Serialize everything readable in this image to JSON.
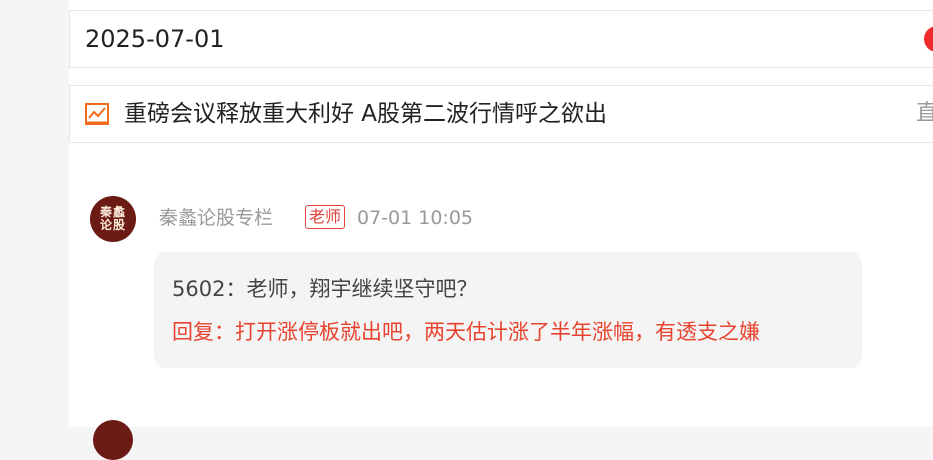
{
  "date_bar": {
    "date": "2025-07-01"
  },
  "news": {
    "icon": "trend-chart-icon",
    "title": "重磅会议释放重大利好 A股第二波行情呼之欲出",
    "extra": "直"
  },
  "post": {
    "avatar_text": [
      "秦蠡",
      "论股"
    ],
    "author": "秦蠡论股专栏",
    "badge": "老师",
    "time": "07-01 10:05",
    "question": "5602：老师，翔宇继续坚守吧？",
    "reply": "回复：打开涨停板就出吧，两天估计涨了半年涨幅，有透支之嫌"
  },
  "colors": {
    "accent_red": "#e8432e",
    "badge_red": "#e0433a",
    "avatar_bg": "#6b1a14",
    "icon_orange": "#f26b1d"
  }
}
